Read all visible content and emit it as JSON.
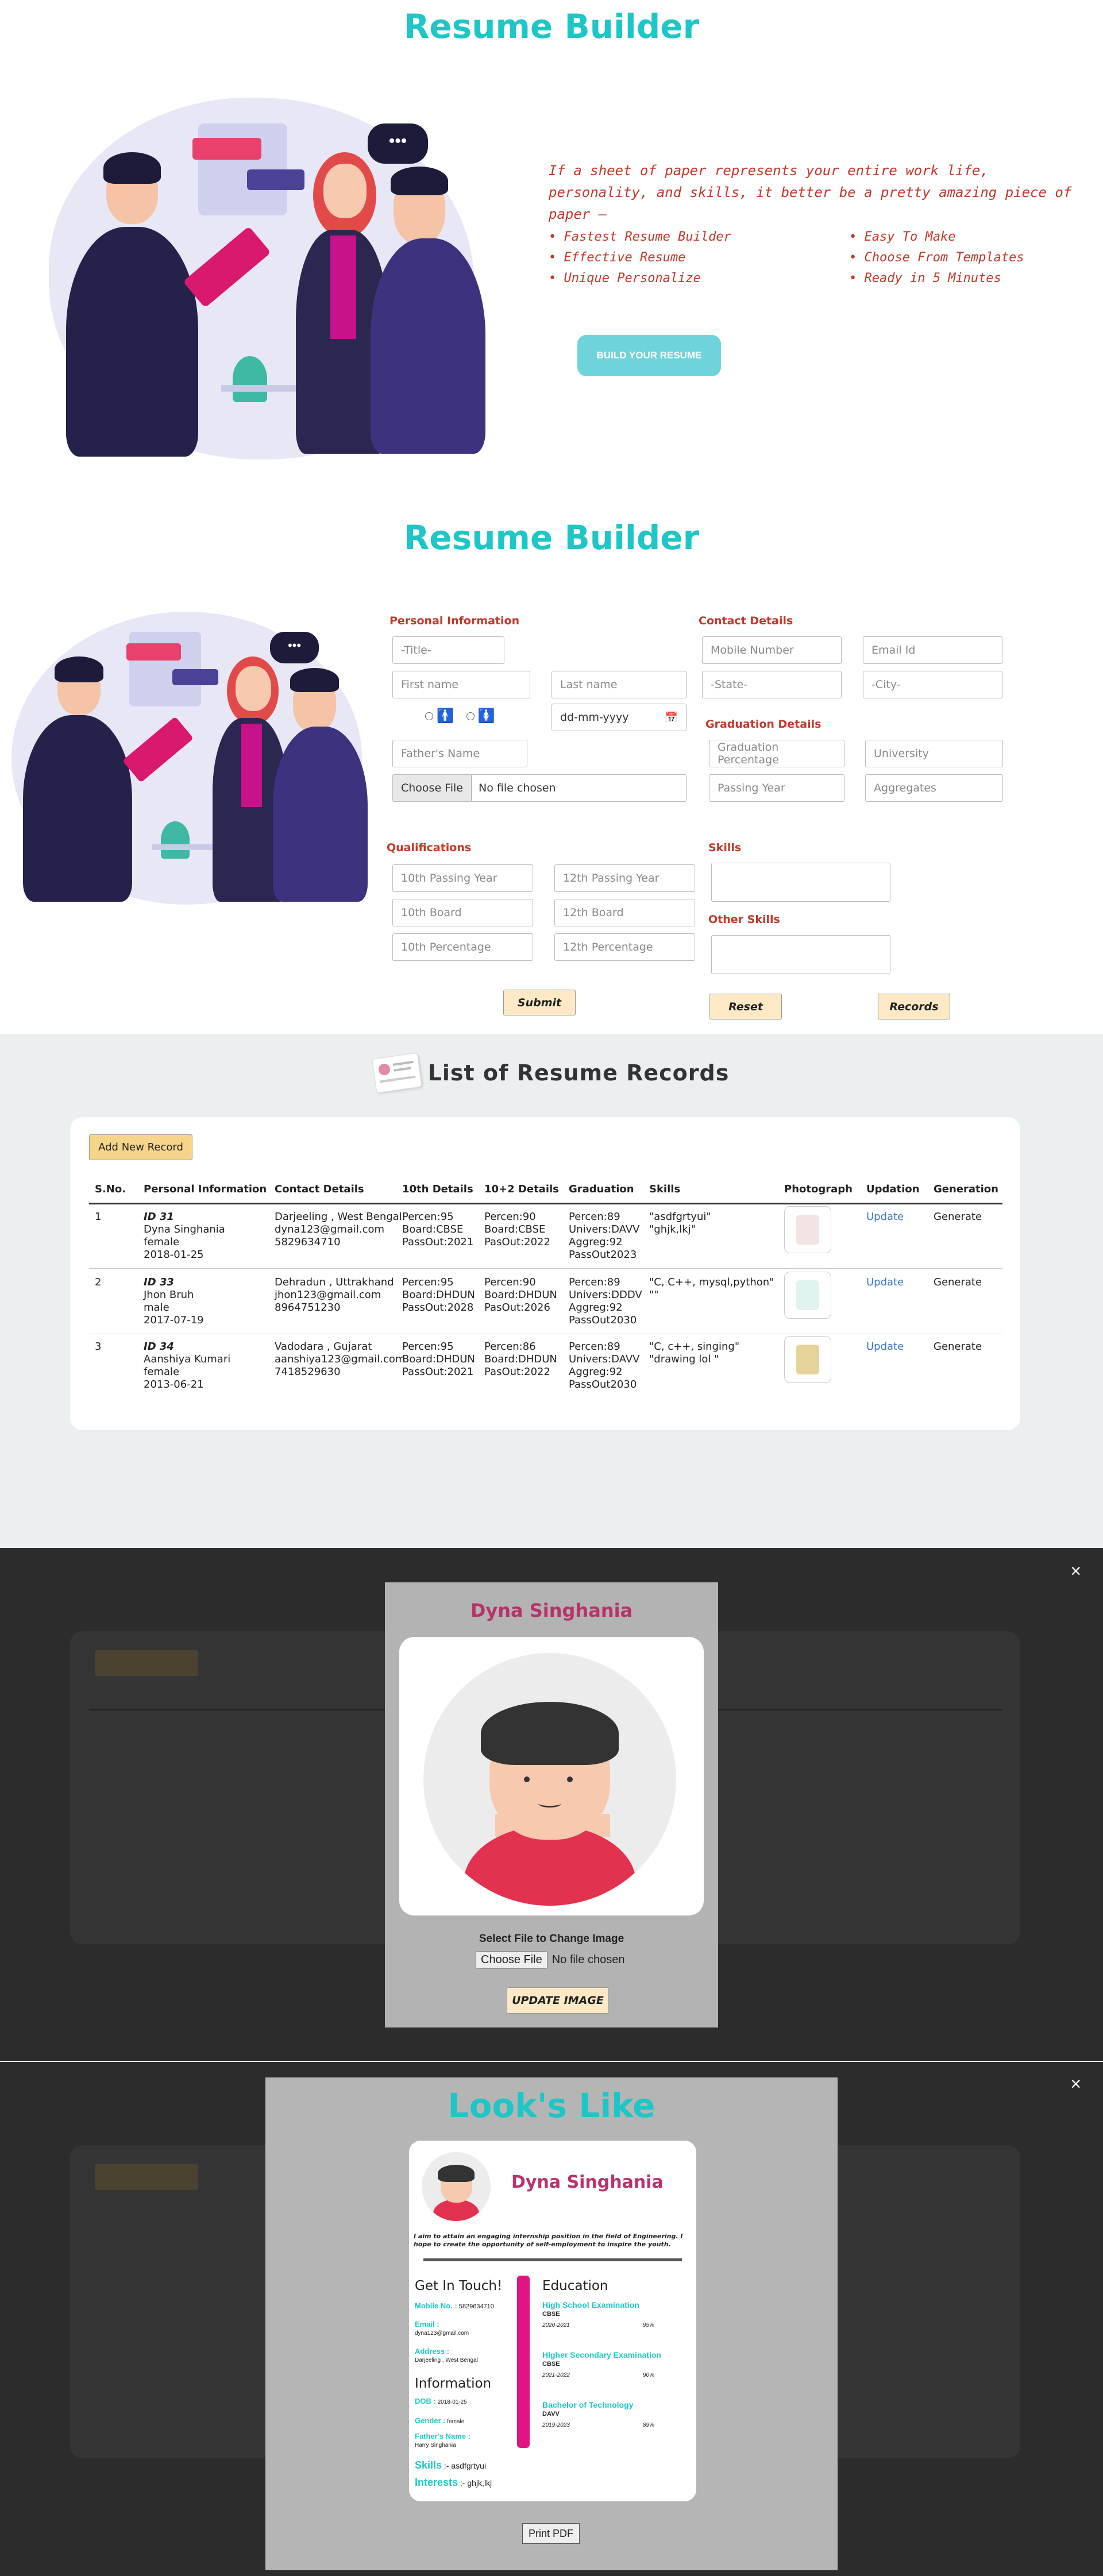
{
  "hero": {
    "title": "Resume Builder",
    "quote": "If a sheet of paper represents your entire work life, personality, and skills, it better be a pretty amazing piece of paper —",
    "features_left": [
      "Fastest Resume Builder",
      "Effective Resume",
      "Unique Personalize"
    ],
    "features_right": [
      "Easy To Make",
      "Choose From Templates",
      "Ready in 5 Minutes"
    ],
    "cta": "BUILD YOUR RESUME",
    "bubble": "•••"
  },
  "form": {
    "title": "Resume Builder",
    "personal_label": "Personal Information",
    "title_select": "-Title-",
    "first_name": "First name",
    "last_name": "Last name",
    "dob": "dd-mm-yyyy",
    "father": "Father's Name",
    "choose_file": "Choose File",
    "no_file": "No file chosen",
    "contact_label": "Contact Details",
    "mobile": "Mobile Number",
    "email": "Email Id",
    "state": "-State-",
    "city": "-City-",
    "grad_label": "Graduation Details",
    "grad_pct": "Graduation Percentage",
    "university": "University",
    "passing_year": "Passing Year",
    "aggregates": "Aggregates",
    "qual_label": "Qualifications",
    "q10_year": "10th Passing Year",
    "q12_year": "12th Passing Year",
    "q10_board": "10th Board",
    "q12_board": "12th Board",
    "q10_pct": "10th Percentage",
    "q12_pct": "12th Percentage",
    "skills_label": "Skills",
    "other_skills_label": "Other Skills",
    "submit": "Submit",
    "reset": "Reset",
    "records": "Records"
  },
  "records": {
    "title": "List of Resume Records",
    "add_new": "Add New Record",
    "headers": [
      "S.No.",
      "Personal Information",
      "Contact Details",
      "10th Details",
      "10+2 Details",
      "Graduation",
      "Skills",
      "Photograph",
      "Updation",
      "Generation"
    ],
    "rows": [
      {
        "sno": "1",
        "id": "ID 31",
        "name": "Dyna Singhania",
        "gender": "female",
        "dob": "2018-01-25",
        "c1": "Darjeeling , West Bengal",
        "c2": "dyna123@gmail.com",
        "c3": "5829634710",
        "t1": "Percen:95",
        "t2": "Board:CBSE",
        "t3": "PassOut:2021",
        "p1": "Percen:90",
        "p2": "Board:CBSE",
        "p3": "PasOut:2022",
        "g1": "Percen:89",
        "g2": "Univers:DAVV",
        "g3": "Aggreg:92",
        "g4": "PassOut2023",
        "s1": "\"asdfgrtyui\"",
        "s2": "\"ghjk,lkj\"",
        "update": "Update",
        "generate": "Generate"
      },
      {
        "sno": "2",
        "id": "ID 33",
        "name": "Jhon Bruh",
        "gender": "male",
        "dob": "2017-07-19",
        "c1": "Dehradun , Uttrakhand",
        "c2": "jhon123@gmail.com",
        "c3": "8964751230",
        "t1": "Percen:95",
        "t2": "Board:DHDUN",
        "t3": "PassOut:2028",
        "p1": "Percen:90",
        "p2": "Board:DHDUN",
        "p3": "PasOut:2026",
        "g1": "Percen:89",
        "g2": "Univers:DDDV",
        "g3": "Aggreg:92",
        "g4": "PassOut2030",
        "s1": "\"C, C++, mysql,python\"",
        "s2": "\"\"",
        "update": "Update",
        "generate": "Generate"
      },
      {
        "sno": "3",
        "id": "ID 34",
        "name": "Aanshiya Kumari",
        "gender": "female",
        "dob": "2013-06-21",
        "c1": "Vadodara , Gujarat",
        "c2": "aanshiya123@gmail.com",
        "c3": "7418529630",
        "t1": "Percen:95",
        "t2": "Board:DHDUN",
        "t3": "PassOut:2021",
        "p1": "Percen:86",
        "p2": "Board:DHDUN",
        "p3": "PasOut:2022",
        "g1": "Percen:89",
        "g2": "Univers:DAVV",
        "g3": "Aggreg:92",
        "g4": "PassOut2030",
        "s1": "\"C, c++, singing\"",
        "s2": "\"drawing lol \"",
        "update": "Update",
        "generate": "Generate"
      }
    ]
  },
  "modal1": {
    "close": "×",
    "name": "Dyna Singhania",
    "select_label": "Select File to Change Image",
    "choose_file": "Choose File",
    "no_file": "No file chosen",
    "update_btn": "UPDATE IMAGE"
  },
  "modal2": {
    "close": "×",
    "title": "Look's Like",
    "name": "Dyna Singhania",
    "objective": "I aim to attain an engaging internship position in the field of Engineering. I hope to create the opportunity of self-employment to inspire the youth.",
    "touch_title": "Get In Touch!",
    "mobile_label": "Mobile No. :",
    "mobile_value": "5829634710",
    "email_label": "Email :",
    "email_value": "dyna123@gmail.com",
    "address_label": "Address :",
    "address_value": "Darjeeling , West Bengal",
    "info_title": "Information",
    "dob_label": "DOB :",
    "dob_value": "2018-01-25",
    "gender_label": "Gender :",
    "gender_value": "female",
    "father_label": "Father's Name :",
    "father_value": "Harry Singhania",
    "skills_label": "Skills",
    "skills_value": ":- asdfgrtyui",
    "interests_label": "Interests",
    "interests_value": ":- ghjk,lkj",
    "edu_title": "Education",
    "edu": [
      {
        "title": "High School Examination",
        "board": "CBSE",
        "years": "2020-2021",
        "pct": "95%"
      },
      {
        "title": "Higher Secondary Examination",
        "board": "CBSE",
        "years": "2021-2022",
        "pct": "90%"
      },
      {
        "title": "Bachelor of Technology",
        "board": "DAVV",
        "years": "2019-2023",
        "pct": "89%"
      }
    ],
    "print_btn": "Print PDF"
  }
}
